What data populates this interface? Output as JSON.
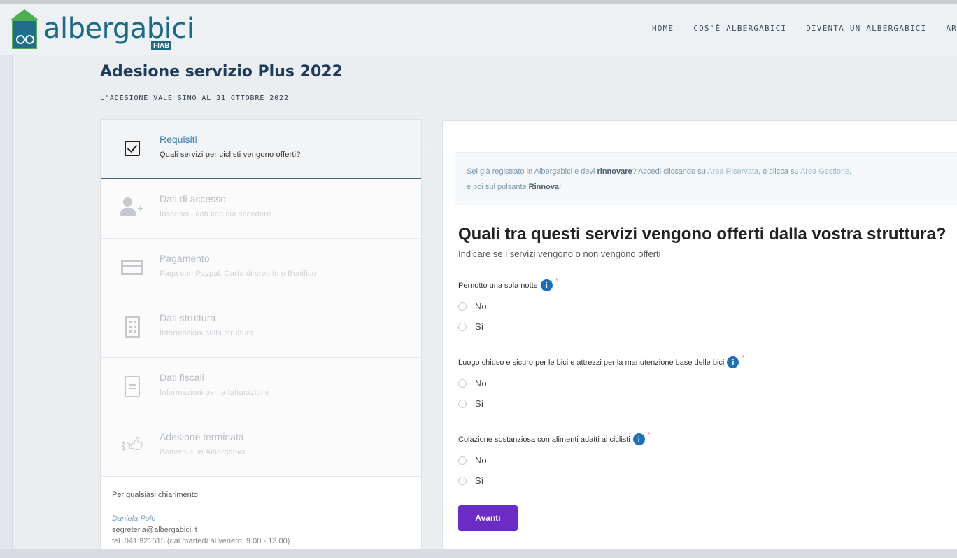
{
  "brand": {
    "name": "albergabici",
    "sub": "FIAB"
  },
  "nav": [
    "HOME",
    "COS'È ALBERGABICI",
    "DIVENTA UN ALBERGABICI",
    "AR"
  ],
  "page": {
    "title": "Adesione servizio Plus 2022",
    "subtitle": "L'ADESIONE VALE SINO AL 31 OTTOBRE 2022"
  },
  "steps": [
    {
      "title": "Requisiti",
      "desc": "Quali servizi per ciclisti vengono offerti?",
      "icon": "checkbox-icon",
      "active": true
    },
    {
      "title": "Dati di accesso",
      "desc": "Inserisci i dati con cui accedere",
      "icon": "user-add-icon",
      "active": false
    },
    {
      "title": "Pagamento",
      "desc": "Paga con Paypal, Carta di credito o Bonifico",
      "icon": "credit-card-icon",
      "active": false
    },
    {
      "title": "Dati struttura",
      "desc": "Informazioni sulla struttura",
      "icon": "building-icon",
      "active": false
    },
    {
      "title": "Dati fiscali",
      "desc": "Informazioni per la fatturazione",
      "icon": "document-icon",
      "active": false
    },
    {
      "title": "Adesione terminata",
      "desc": "Benvenuti in Albergabici",
      "icon": "thumbs-up-icon",
      "active": false
    }
  ],
  "contact": {
    "title": "Per qualsiasi chiarimento",
    "name": "Daniela Polo",
    "email": "segreteria@albergabici.it",
    "tel": "tel. 041 921515 (dal martedì al venerdì 9.00 - 13.00)"
  },
  "notice": {
    "text1": "Sei già registrato in Albergabici e devi ",
    "bold1": "rinnovare",
    "text2": "? Accedi cliccando su ",
    "link1": "Area Riservata",
    "text3": ", o clicca su ",
    "link2": "Area Gestione",
    "text4": ",",
    "text5": "e poi sul pulsante ",
    "bold2": "Rinnova",
    "text6": "!"
  },
  "form": {
    "title": "Quali tra questi servizi vengono offerti dalla vostra struttura?",
    "subtitle": "Indicare se i servizi vengono o non vengono offerti",
    "questions": [
      {
        "label": "Pernotto una sola notte",
        "options": [
          "No",
          "Sì"
        ]
      },
      {
        "label": "Luogo chiuso e sicuro per le bici e attrezzi per la manutenzione base delle bici",
        "options": [
          "No",
          "Sì"
        ]
      },
      {
        "label": "Colazione sostanziosa con alimenti adatti ai ciclisti",
        "options": [
          "No",
          "Sì"
        ]
      }
    ],
    "info_glyph": "i",
    "required_mark": "*",
    "submit_label": "Avanti"
  },
  "colors": {
    "accent": "#6a2cc4",
    "brand": "#1b6b86",
    "info": "#1d6fb8"
  }
}
